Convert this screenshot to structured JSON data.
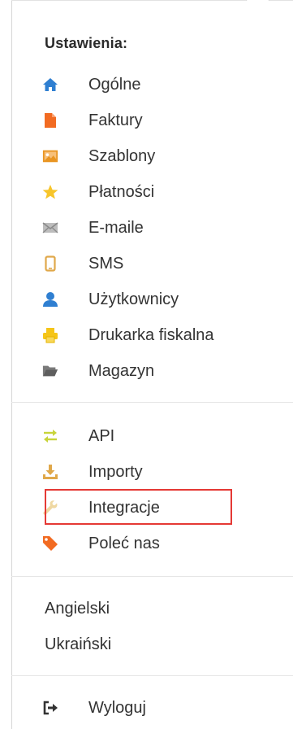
{
  "menu": {
    "header": "Ustawienia:",
    "settings_items": [
      {
        "label": "Ogólne",
        "icon": "home-icon"
      },
      {
        "label": "Faktury",
        "icon": "file-icon"
      },
      {
        "label": "Szablony",
        "icon": "image-icon"
      },
      {
        "label": "Płatności",
        "icon": "star-icon"
      },
      {
        "label": "E-maile",
        "icon": "envelope-icon"
      },
      {
        "label": "SMS",
        "icon": "mobile-icon"
      },
      {
        "label": "Użytkownicy",
        "icon": "user-icon"
      },
      {
        "label": "Drukarka fiskalna",
        "icon": "printer-icon"
      },
      {
        "label": "Magazyn",
        "icon": "folder-open-icon"
      }
    ],
    "tools_items": [
      {
        "label": "API",
        "icon": "exchange-arrows-icon"
      },
      {
        "label": "Importy",
        "icon": "download-icon"
      },
      {
        "label": "Integracje",
        "icon": "wrench-icon"
      },
      {
        "label": "Poleć nas",
        "icon": "tag-icon"
      }
    ],
    "languages": [
      {
        "label": "Angielski"
      },
      {
        "label": "Ukraiński"
      }
    ],
    "logout": {
      "label": "Wyloguj",
      "icon": "sign-out-icon"
    }
  },
  "colors": {
    "home": "#2f7fd1",
    "file": "#f26b22",
    "image": "#e99522",
    "star": "#f7c52a",
    "envelope": "#9e9e9e",
    "mobile": "#e0a84a",
    "user": "#2f7fd1",
    "printer": "#f5c518",
    "folder": "#666666",
    "api": "#c8d43a",
    "download": "#e0a84a",
    "wrench": "#efd8a2",
    "tag": "#f26b22",
    "highlight": "#e53935"
  }
}
